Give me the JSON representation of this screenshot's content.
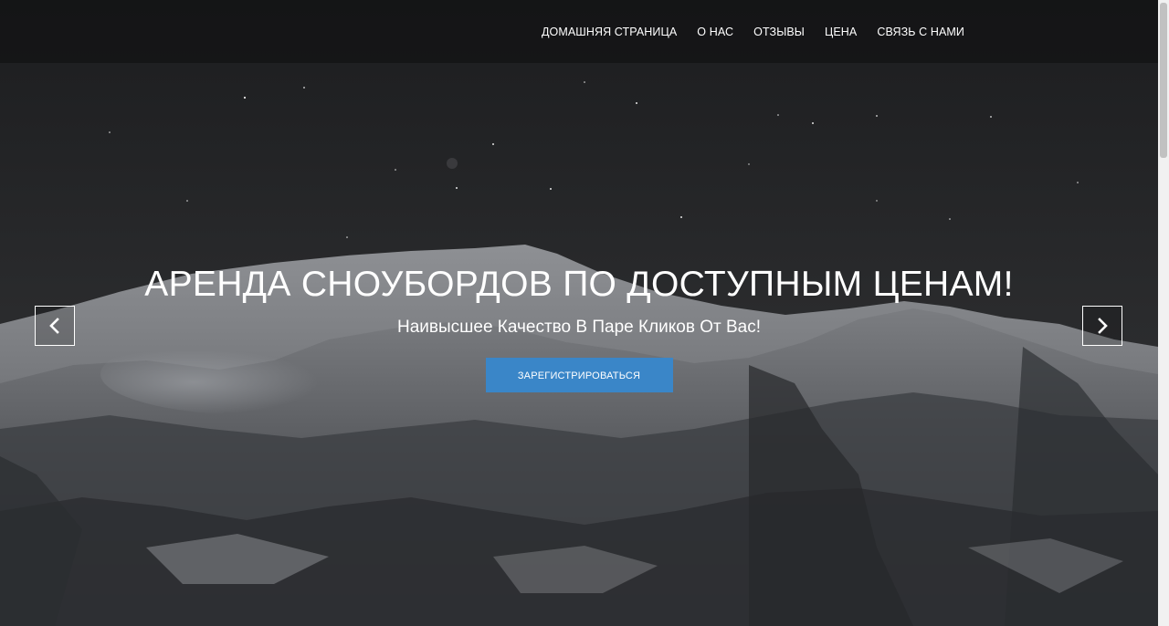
{
  "nav": {
    "items": [
      {
        "label": "ДОМАШНЯЯ СТРАНИЦА"
      },
      {
        "label": "О НАС"
      },
      {
        "label": "ОТЗЫВЫ"
      },
      {
        "label": "ЦЕНА"
      },
      {
        "label": "СВЯЗЬ С НАМИ"
      }
    ]
  },
  "hero": {
    "title": "АРЕНДА СНОУБОРДОВ ПО ДОСТУПНЫМ ЦЕНАМ!",
    "subtitle": "Наивысшее Качество В Паре Кликов От Вас!",
    "cta_label": "ЗАРЕГИСТРИРОВАТЬСЯ",
    "cta_color": "#3a86c8",
    "background": "night-snowy-mountains-photo"
  },
  "carousel": {
    "prev_icon": "chevron-left-icon",
    "next_icon": "chevron-right-icon"
  }
}
